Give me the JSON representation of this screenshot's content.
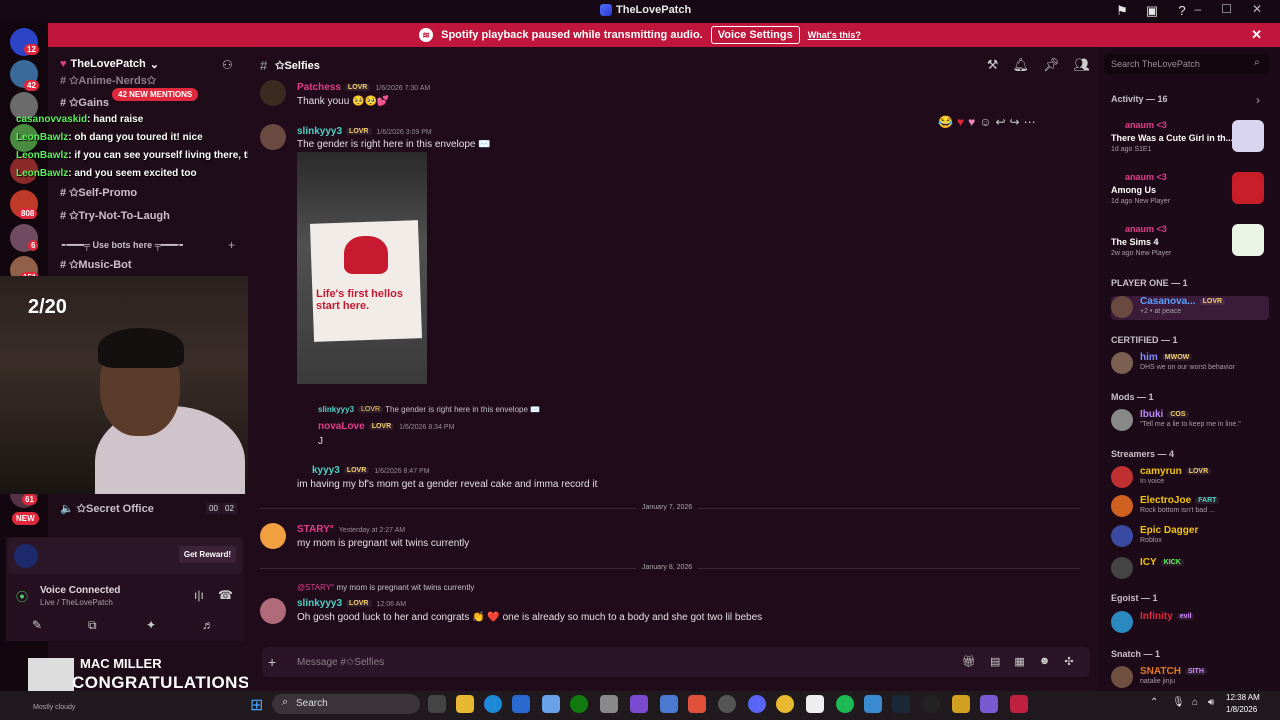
{
  "window": {
    "title": "TheLovePatch"
  },
  "notice": {
    "text": "Spotify playback paused while transmitting audio.",
    "button": "Voice Settings",
    "link": "What's this?"
  },
  "rail": {
    "badges": [
      "12",
      "42",
      "6",
      "808",
      "6",
      "151",
      "61"
    ],
    "new_label": "NEW"
  },
  "sidebar": {
    "server_name": "TheLovePatch",
    "mention_pill": "42 NEW MENTIONS",
    "channels": [
      {
        "label": "✩Anime-Nerds✩"
      },
      {
        "label": "✩Gains"
      },
      {
        "label": "✩Self-Promo"
      },
      {
        "label": "✩Try-Not-To-Laugh"
      },
      {
        "label": "╾━━━╤ Use bots here ╤━━━╼"
      },
      {
        "label": "✩Music-Bot"
      }
    ],
    "voice_channel": "✩Secret Office",
    "voice_counts": [
      "00",
      "02"
    ],
    "reward_button": "Get Reward!",
    "voice_connected": "Voice Connected",
    "voice_location": "Live / TheLovePatch"
  },
  "stream_overlay": {
    "chat": [
      {
        "name": "casanovvaskid",
        "text": ": hand raise"
      },
      {
        "name": "LeonBawlz",
        "text": ": oh dang you toured it! nice"
      },
      {
        "name": "LeonBawlz",
        "text": ": if you can see yourself living there, that's the one"
      },
      {
        "name": "LeonBawlz",
        "text": ": and you seem excited too"
      }
    ],
    "counter": "2/20",
    "now_playing": {
      "artist": "MAC MILLER",
      "title": "CONGRATULATIONS (F"
    },
    "weather": "Mostly cloudy"
  },
  "channel": {
    "name": "✩Selfies",
    "input_placeholder": "Message #✩Selfies"
  },
  "messages": [
    {
      "author": "Patchess",
      "tag": "LOVR",
      "time": "1/6/2026 7:30 AM",
      "text": "Thank youu 🥺🥺💕"
    },
    {
      "author": "slinkyyy3",
      "tag": "LOVR",
      "time": "1/6/2026 3:09 PM",
      "text": "The gender is right here in this envelope ✉️"
    },
    {
      "reply_author": "slinkyyy3",
      "reply_tag": "LOVR",
      "reply_text": "The gender is right here in this envelope ✉️",
      "author": "novaLove",
      "tag": "LOVR",
      "time": "1/6/2026 8:34 PM",
      "text": "J"
    },
    {
      "author": "kyyy3",
      "tag": "LOVR",
      "time": "1/6/2026 8:47 PM",
      "text": "im having my bf's mom get a gender reveal cake and imma record it"
    },
    {
      "author": "STARY°",
      "tag": "",
      "time": "Yesterday at 2:27 AM",
      "text": "my mom is pregnant wit twins currently"
    },
    {
      "reply_author": "@STARY°",
      "reply_text": "my mom is pregnant wit twins currently",
      "author": "slinkyyy3",
      "tag": "LOVR",
      "time": "12:06 AM",
      "text": "Oh gosh good luck to her and congrats 👏 ❤️ one is already so much to a body and she got two lil bebes"
    }
  ],
  "dividers": [
    "January 7, 2026",
    "January 8, 2026"
  ],
  "attachment_card": {
    "text": "Life's first hellos start here."
  },
  "members": {
    "search_placeholder": "Search TheLovePatch",
    "activity_header": "Activity — 16",
    "activities": [
      {
        "user": "anaum <3",
        "game": "There Was a Cute Girl in th...",
        "meta": "1d ago  S1E1"
      },
      {
        "user": "anaum <3",
        "game": "Among Us",
        "meta": "1d ago  New Player"
      },
      {
        "user": "anaum <3",
        "game": "The Sims 4",
        "meta": "2w ago  New Player"
      }
    ],
    "sections": [
      {
        "title": "PLAYER ONE — 1",
        "members": [
          {
            "name": "Casanova...",
            "tag": "LOVR",
            "status": "+2 • at peace",
            "color": "#5aa0ff"
          }
        ]
      },
      {
        "title": "CERTIFIED — 1",
        "members": [
          {
            "name": "him",
            "tag": "MWOW",
            "status": "DHS we on our worst behavior",
            "color": "#7f8cff"
          }
        ]
      },
      {
        "title": "Mods — 1",
        "members": [
          {
            "name": "Ibuki",
            "tag": "COS",
            "status": "\"Tell me a lie to keep me in line.\"",
            "color": "#b98bff"
          }
        ]
      },
      {
        "title": "Streamers — 4",
        "members": [
          {
            "name": "camyrun",
            "tag": "LOVR",
            "status": "In voice",
            "color": "#f1c40f"
          },
          {
            "name": "ElectroJoe",
            "tag": "FART",
            "status": "Rock bottom isn't bad ...",
            "color": "#f1c40f"
          },
          {
            "name": "Epic Dagger",
            "tag": "",
            "status": "Roblox",
            "color": "#f1c40f"
          },
          {
            "name": "ICY",
            "tag": "KICK",
            "status": "",
            "color": "#f1c40f"
          }
        ]
      },
      {
        "title": "Egoist — 1",
        "members": [
          {
            "name": "Infinity",
            "tag": "evil",
            "status": "",
            "color": "#e0283c"
          }
        ]
      },
      {
        "title": "Snatch — 1",
        "members": [
          {
            "name": "SNATCH",
            "tag": "SITH",
            "status": "natalie jinju",
            "color": "#e07a1f"
          }
        ]
      }
    ]
  },
  "taskbar": {
    "search": "Search",
    "time": "12:38 AM",
    "date": "1/8/2026"
  },
  "colors": {
    "accent": "#c0163b",
    "bg": "#1f0b1a",
    "author_pink": "#e13e8a",
    "author_green": "#4fd1c5"
  }
}
